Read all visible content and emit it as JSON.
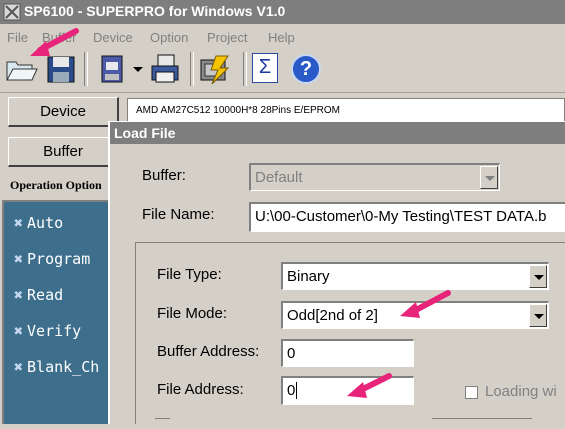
{
  "window": {
    "title": "SP6100 - SUPERPRO for Windows V1.0"
  },
  "menu": [
    "File",
    "Buffer",
    "Device",
    "Option",
    "Project",
    "Help"
  ],
  "toolbar": {
    "icons": [
      "open-folder-icon",
      "save-icon",
      "clipboard-icon",
      "dropdown-arrow-icon",
      "print-icon",
      "run-program-icon",
      "sigma-icon",
      "help-icon"
    ],
    "sigma_glyph": "Σ",
    "help_glyph": "?"
  },
  "device": {
    "button_label": "Device",
    "info": "AMD  AM27C512  10000H*8  28Pins  E/EPROM"
  },
  "buffer": {
    "button_label": "Buffer"
  },
  "operations": {
    "header": "Operation Option",
    "items": [
      "Auto",
      "Program",
      "Read",
      "Verify",
      "Blank_Ch"
    ]
  },
  "dialog": {
    "title": "Load File",
    "buffer_label": "Buffer:",
    "buffer_value": "Default",
    "file_name_label": "File Name:",
    "file_name_value": "U:\\00-Customer\\0-My Testing\\TEST DATA.b",
    "file_type_label": "File Type:",
    "file_type_value": "Binary",
    "file_mode_label": "File Mode:",
    "file_mode_value": "Odd[2nd of 2]",
    "buffer_address_label": "Buffer Address:",
    "buffer_address_value": "0",
    "file_address_label": "File Address:",
    "file_address_value": "0",
    "loading_label": "Loading wi"
  },
  "colors": {
    "annotation_arrow": "#e8247a",
    "title_bar": "#7e7e7e",
    "operation_panel": "#3d6e8c"
  }
}
